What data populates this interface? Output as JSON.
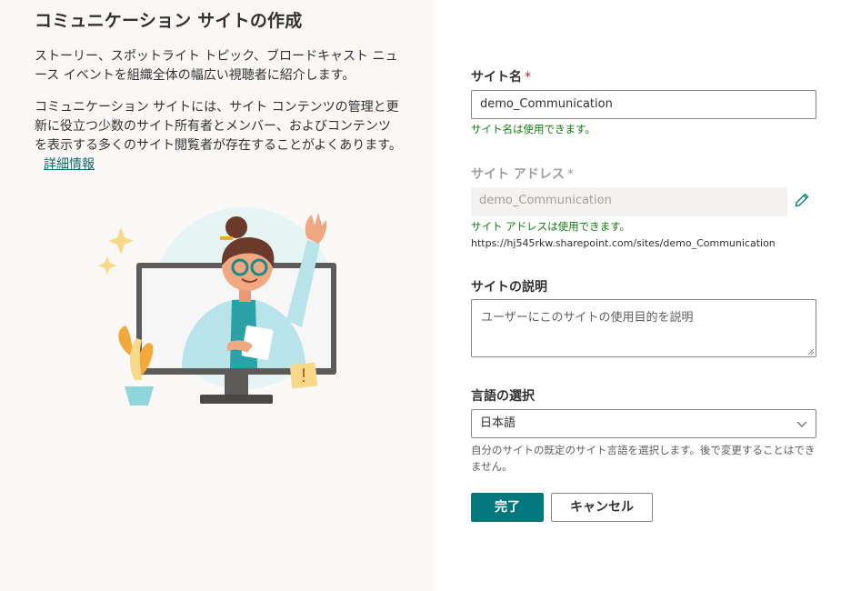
{
  "left": {
    "title": "コミュニケーション サイトの作成",
    "description1": "ストーリー、スポットライト トピック、ブロードキャスト ニュース イベントを組織全体の幅広い視聴者に紹介します。",
    "description2": "コミュニケーション サイトには、サイト コンテンツの管理と更新に役立つ少数のサイト所有者とメンバー、およびコンテンツを表示する多くのサイト閲覧者が存在することがよくあります。",
    "learn_more": "詳細情報"
  },
  "form": {
    "site_name": {
      "label": "サイト名",
      "required_mark": "*",
      "value": "demo_Communication",
      "status": "サイト名は使用できます。"
    },
    "site_address": {
      "label": "サイト アドレス",
      "required_mark": "*",
      "value": "demo_Communication",
      "status": "サイト アドレスは使用できます。",
      "url": "https://hj545rkw.sharepoint.com/sites/demo_Communication",
      "edit_icon": "pencil-icon"
    },
    "description": {
      "label": "サイトの説明",
      "placeholder": "ユーザーにこのサイトの使用目的を説明"
    },
    "language": {
      "label": "言語の選択",
      "selected": "日本語",
      "help": "自分のサイトの既定のサイト言語を選択します。後で変更することはできません。"
    },
    "buttons": {
      "finish": "完了",
      "cancel": "キャンセル"
    }
  },
  "colors": {
    "accent": "#03787c",
    "success": "#107c10",
    "required": "#a4262c",
    "left_bg": "#faf9f8"
  }
}
